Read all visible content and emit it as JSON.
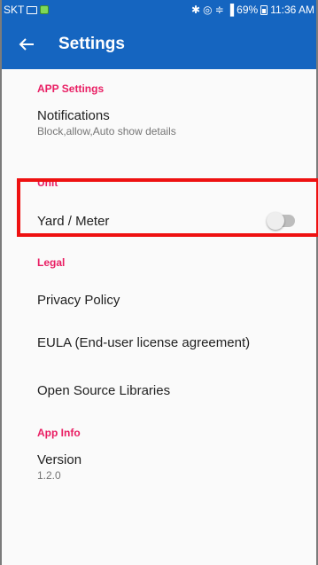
{
  "status_bar": {
    "carrier": "SKT",
    "battery": "69%",
    "time": "11:36 AM"
  },
  "app_bar": {
    "title": "Settings",
    "back_icon": "arrow-left-icon"
  },
  "sections": {
    "app_settings": {
      "header": "APP Settings",
      "notifications_title": "Notifications",
      "notifications_summary": "Block,allow,Auto show details"
    },
    "unit": {
      "header": "Unit",
      "yard_meter_title": "Yard / Meter",
      "yard_meter_enabled": false
    },
    "legal": {
      "header": "Legal",
      "privacy": "Privacy Policy",
      "eula": "EULA (End-user license agreement)",
      "open_source": "Open Source Libraries"
    },
    "app_info": {
      "header": "App Info",
      "version_title": "Version",
      "version_value": "1.2.0"
    }
  },
  "colors": {
    "primary": "#1565c0",
    "accent": "#e91e63",
    "highlight": "#ee1111"
  }
}
